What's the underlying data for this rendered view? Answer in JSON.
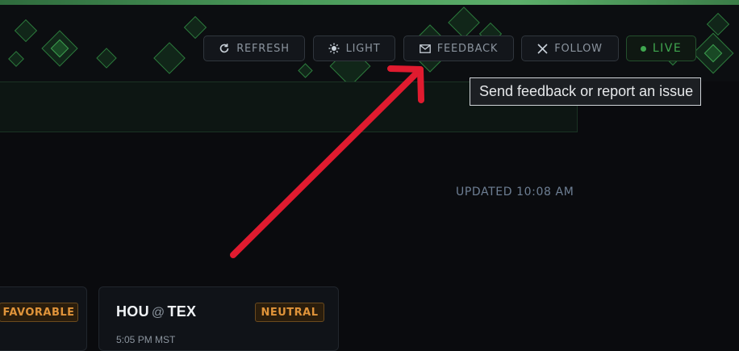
{
  "header": {
    "buttons": {
      "refresh": {
        "label": "REFRESH",
        "icon": "refresh-icon"
      },
      "light": {
        "label": "LIGHT",
        "icon": "sun-icon"
      },
      "feedback": {
        "label": "FEEDBACK",
        "icon": "envelope-icon"
      },
      "follow": {
        "label": "FOLLOW",
        "icon": "x-logo-icon"
      },
      "live": {
        "label": "LIVE"
      }
    }
  },
  "tooltip": {
    "text": "Send feedback or report an issue"
  },
  "status": {
    "updated": "UPDATED 10:08 AM"
  },
  "cards": [
    {
      "badge": "FAVORABLE"
    },
    {
      "away": "HOU",
      "at": "@",
      "home": "TEX",
      "badge": "NEUTRAL",
      "time": "5:05 PM MST"
    }
  ],
  "colors": {
    "background": "#0a0b0e",
    "accent_green": "#3fa64f",
    "badge_orange": "#e0943a",
    "annotation_red": "#e01b2f"
  }
}
